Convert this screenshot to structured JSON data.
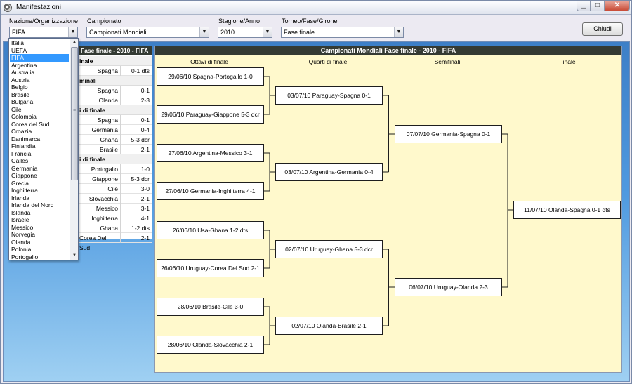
{
  "window": {
    "title": "Manifestazioni",
    "min_glyph": "▁",
    "max_glyph": "□",
    "close_glyph": "✕"
  },
  "filters": {
    "nazione": {
      "label": "Nazione/Organizzazione",
      "value": "FIFA"
    },
    "campionato": {
      "label": "Campionato",
      "value": "Campionati Mondiali"
    },
    "stagione": {
      "label": "Stagione/Anno",
      "value": "2010"
    },
    "torneo": {
      "label": "Torneo/Fase/Girone",
      "value": "Fase finale"
    },
    "arrow_glyph": "▼"
  },
  "close_button": "Chiudi",
  "dropdown": {
    "items": [
      "Italia",
      "UEFA",
      "FIFA",
      "Argentina",
      "Australia",
      "Austria",
      "Belgio",
      "Brasile",
      "Bulgaria",
      "Cile",
      "Colombia",
      "Corea del Sud",
      "Croazia",
      "Danimarca",
      "Finlandia",
      "Francia",
      "Galles",
      "Germania",
      "Giappone",
      "Grecia",
      "Inghilterra",
      "Irlanda",
      "Irlanda del Nord",
      "Islanda",
      "Israele",
      "Messico",
      "Norvegia",
      "Olanda",
      "Polonia",
      "Portogallo"
    ],
    "selected_index": 2,
    "up_glyph": "▲",
    "down_glyph": "▼",
    "grip_glyph": "≡"
  },
  "left_panel": {
    "header": "Fase finale - 2010 - FIFA",
    "sections": [
      {
        "title": "inale",
        "rows": [
          {
            "team": "Spagna",
            "score": "0-1 dts"
          }
        ]
      },
      {
        "title": "minali",
        "rows": [
          {
            "team": "Spagna",
            "score": "0-1"
          },
          {
            "team": "Olanda",
            "score": "2-3"
          }
        ]
      },
      {
        "title": "i di finale",
        "rows": [
          {
            "team": "Spagna",
            "score": "0-1"
          },
          {
            "team": "Germania",
            "score": "0-4"
          },
          {
            "team": "Ghana",
            "score": "5-3 dcr"
          },
          {
            "team": "Brasile",
            "score": "2-1"
          }
        ]
      },
      {
        "title": "i di finale",
        "rows": [
          {
            "team": "Portogallo",
            "score": "1-0"
          },
          {
            "team": "Giappone",
            "score": "5-3 dcr"
          },
          {
            "team": "Cile",
            "score": "3-0"
          },
          {
            "team": "Slovacchia",
            "score": "2-1"
          },
          {
            "team": "Messico",
            "score": "3-1"
          },
          {
            "team": "Inghilterra",
            "score": "4-1"
          },
          {
            "team": "Ghana",
            "score": "1-2 dts"
          },
          {
            "team": "Corea Del Sud",
            "score": "2-1"
          }
        ]
      }
    ]
  },
  "bracket": {
    "header": "Campionati Mondiali Fase finale - 2010 - FIFA",
    "columns": [
      "Ottavi di finale",
      "Quarti di finale",
      "Semifinali",
      "Finale"
    ],
    "ottavi": [
      "29/06/10  Spagna-Portogallo  1-0",
      "29/06/10  Paraguay-Giappone  5-3 dcr",
      "27/06/10  Argentina-Messico  3-1",
      "27/06/10  Germania-Inghilterra  4-1",
      "26/06/10  Usa-Ghana  1-2 dts",
      "26/06/10  Uruguay-Corea Del Sud  2-1",
      "28/06/10  Brasile-Cile  3-0",
      "28/06/10  Olanda-Slovacchia  2-1"
    ],
    "quarti": [
      "03/07/10  Paraguay-Spagna  0-1",
      "03/07/10  Argentina-Germania  0-4",
      "02/07/10  Uruguay-Ghana  5-3 dcr",
      "02/07/10  Olanda-Brasile  2-1"
    ],
    "semifinali": [
      "07/07/10  Germania-Spagna  0-1",
      "06/07/10  Uruguay-Olanda  2-3"
    ],
    "finale": [
      "11/07/10  Olanda-Spagna  0-1 dts"
    ]
  }
}
